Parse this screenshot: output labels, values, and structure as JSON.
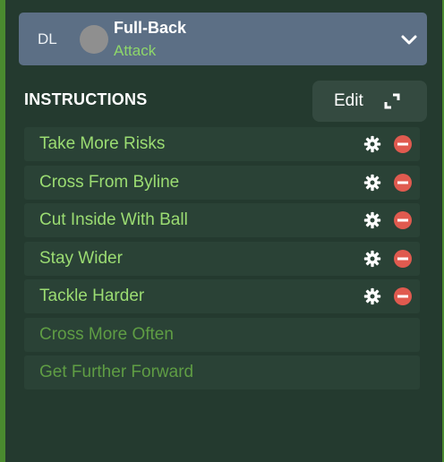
{
  "role": {
    "position_code": "DL",
    "title": "Full-Back",
    "duty": "Attack"
  },
  "instructions": {
    "heading": "INSTRUCTIONS",
    "edit_label": "Edit",
    "items": [
      {
        "label": "Take More Risks",
        "active": true
      },
      {
        "label": "Cross From Byline",
        "active": true
      },
      {
        "label": "Cut Inside With Ball",
        "active": true
      },
      {
        "label": "Stay Wider",
        "active": true
      },
      {
        "label": "Tackle Harder",
        "active": true
      },
      {
        "label": "Cross More Often",
        "active": false
      },
      {
        "label": "Get Further Forward",
        "active": false
      }
    ]
  },
  "icons": {
    "dropdown": "chevron-down-icon",
    "edit": "expand-icon",
    "settings": "gear-icon",
    "remove": "remove-icon"
  },
  "colors": {
    "role_bar": "#5c6f85",
    "duty": "#8ed76a",
    "item_active": "#9bdc72",
    "item_inactive": "#5f9d44",
    "remove": "#e05a4f"
  }
}
